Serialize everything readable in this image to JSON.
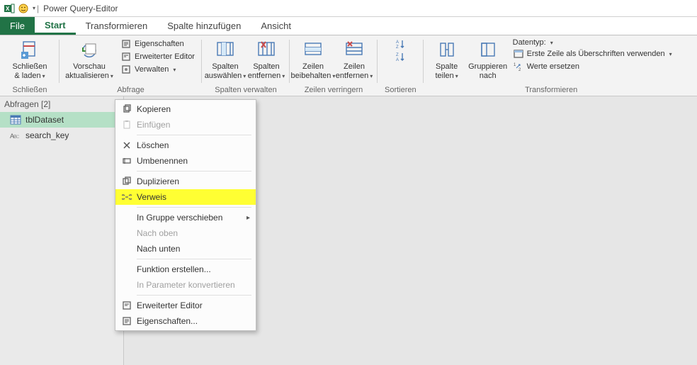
{
  "title": "Power Query-Editor",
  "tabs": {
    "file": "File",
    "start": "Start",
    "transform": "Transformieren",
    "addcol": "Spalte hinzufügen",
    "view": "Ansicht"
  },
  "ribbon": {
    "close": {
      "btn": "Schließen\n& laden",
      "group": "Schließen"
    },
    "query": {
      "refresh": "Vorschau\naktualisieren",
      "props": "Eigenschaften",
      "adv": "Erweiterter Editor",
      "manage": "Verwalten",
      "group": "Abfrage"
    },
    "cols": {
      "choose": "Spalten\nauswählen",
      "remove": "Spalten\nentfernen",
      "group": "Spalten verwalten"
    },
    "rows": {
      "keep": "Zeilen\nbeibehalten",
      "remove": "Zeilen\nentfernen",
      "group": "Zeilen verringern"
    },
    "sort": {
      "group": "Sortieren"
    },
    "transform": {
      "split": "Spalte\nteilen",
      "groupby": "Gruppieren\nnach",
      "datatype": "Datentyp:",
      "firstrow": "Erste Zeile als Überschriften verwenden",
      "replace": "Werte ersetzen",
      "group": "Transformieren"
    }
  },
  "queries": {
    "header": "Abfragen [2]",
    "items": [
      {
        "name": "tblDataset",
        "kind": "table",
        "selected": true
      },
      {
        "name": "search_key",
        "kind": "text",
        "selected": false
      }
    ]
  },
  "context_menu": {
    "copy": "Kopieren",
    "paste": "Einfügen",
    "delete": "Löschen",
    "rename": "Umbenennen",
    "duplicate": "Duplizieren",
    "reference": "Verweis",
    "movegroup": "In Gruppe verschieben",
    "moveup": "Nach oben",
    "movedown": "Nach unten",
    "createfn": "Funktion erstellen...",
    "toparam": "In Parameter konvertieren",
    "adv": "Erweiterter Editor",
    "props": "Eigenschaften..."
  }
}
